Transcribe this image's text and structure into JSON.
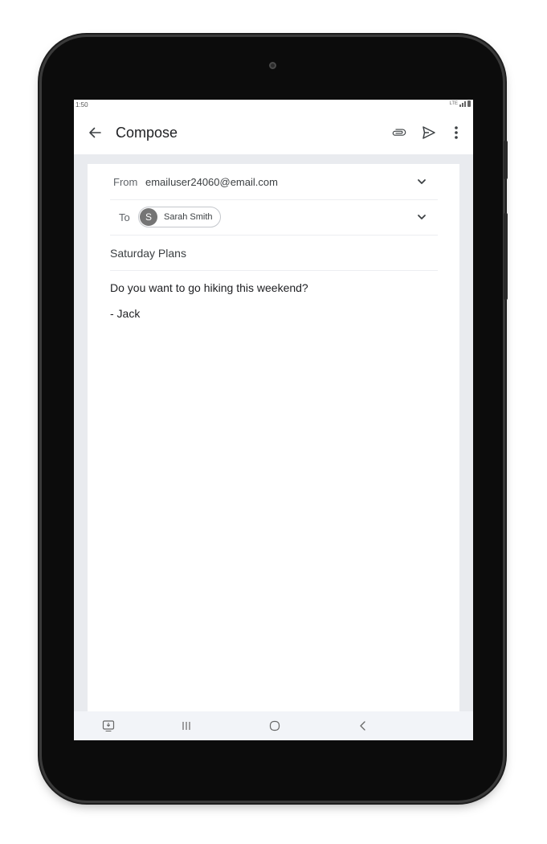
{
  "device": {
    "frame_color": "#0c0c0c",
    "screen_bg": "#e9ebef"
  },
  "status_bar": {
    "time": "1:50",
    "icons": [
      "lte-icon",
      "signal-icon",
      "battery-icon"
    ]
  },
  "app_bar": {
    "title": "Compose",
    "back_icon": "arrow-back-icon",
    "actions": [
      "attach-icon",
      "send-icon",
      "more-vert-icon"
    ]
  },
  "compose": {
    "from_label": "From",
    "from_value": "emailuser24060@email.com",
    "to_label": "To",
    "recipients": [
      {
        "initial": "S",
        "name": "Sarah Smith",
        "avatar_color": "#757575"
      }
    ],
    "subject": "Saturday Plans",
    "body_lines": [
      "Do you want to go hiking this weekend?",
      "- Jack"
    ]
  },
  "nav_bar": {
    "icons": [
      "keyboard-switch-icon",
      "recent-apps-icon",
      "home-icon",
      "back-nav-icon"
    ]
  }
}
